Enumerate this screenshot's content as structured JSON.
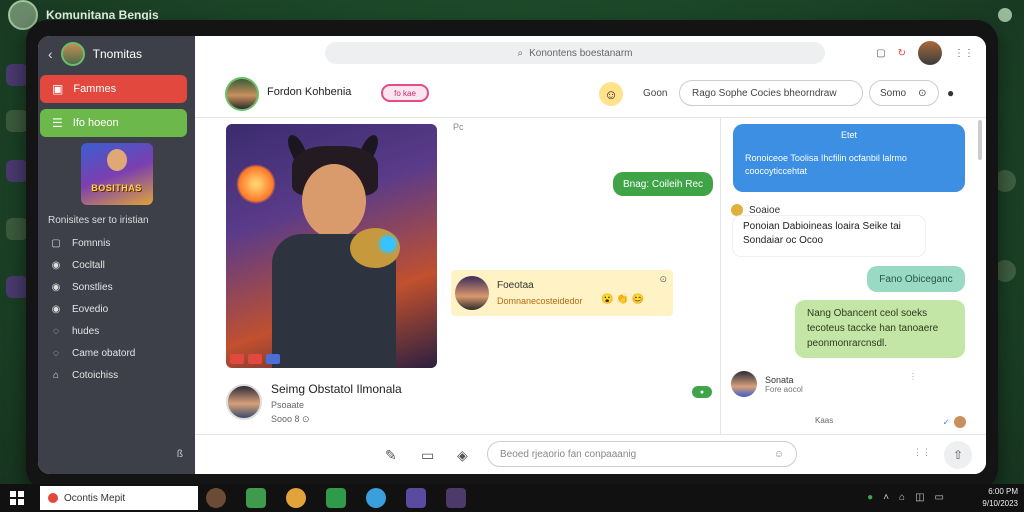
{
  "background": {
    "title": "Komunitana Bengis"
  },
  "sidebar": {
    "title": "Tnomitas",
    "btn_red": "Fammes",
    "btn_green": "Ifo hoeon",
    "game_logo": "BOSITHAS",
    "section": "Ronisites ser to iristian",
    "items": [
      {
        "label": "Fomnnis",
        "icon": "profile-icon"
      },
      {
        "label": "Cocltall",
        "icon": "chat-icon"
      },
      {
        "label": "Sonstlies",
        "icon": "chat-icon"
      },
      {
        "label": "Eovedio",
        "icon": "chat-icon"
      },
      {
        "label": "hudes",
        "icon": "chat-icon"
      },
      {
        "label": "Came obatord",
        "icon": "chat-icon"
      },
      {
        "label": "Cotoichiss",
        "icon": "home-icon"
      }
    ],
    "bottom": "ß"
  },
  "topbar": {
    "search_placeholder": "Konontens boestanarm"
  },
  "chat_header": {
    "name": "Fordon Kohbenia",
    "pill": "fo kae",
    "label": "Goon",
    "field_text": "Rago Sophe Cocies bheorndraw",
    "field2_text": "Somo"
  },
  "post": {
    "title": "Seimg Obstatol Ilmonala",
    "subtitle": "Psoaate",
    "meta": "Sooo 8 ⊙"
  },
  "middle": {
    "top_meta": "Pc",
    "green_bubble": "Bnag: Coileih Rec",
    "card_name": "Foeotaa",
    "card_desc": "Domnanecosteidedor",
    "badge": "●"
  },
  "right": {
    "blue_header": "Etet",
    "blue_line1": "Ronoiceoe Toolisa Ihcfilin ocfanbil lalrmo",
    "blue_line2": "coocoyticcehtat",
    "sender1": "Soaioe",
    "white_line1": "Ponoian Dabioineas loaira Seike tai",
    "white_line2": "Sondaiar oc Ocoo",
    "teal_bubble": "Fano Obiceganc",
    "green_line1": "Nang Obancent ceol soeks",
    "green_line2": "tecoteus taccke han tanoaere",
    "green_line3": "peonmonrarcnsdl.",
    "sender2_name": "Sonata",
    "sender2_sub": "Fore aocol",
    "tail": "Kaas"
  },
  "composer": {
    "placeholder": "Beoed rjeaorio fan conpaaanig"
  },
  "taskbar": {
    "search": "Ocontis Mepit",
    "clock_line1": "6:00 PM",
    "clock_line2": "9/10/2023"
  },
  "colors": {
    "accent_red": "#e2483d",
    "accent_green": "#6db84a",
    "bubble_blue": "#3c8fe2",
    "bubble_green": "#3fa447"
  }
}
